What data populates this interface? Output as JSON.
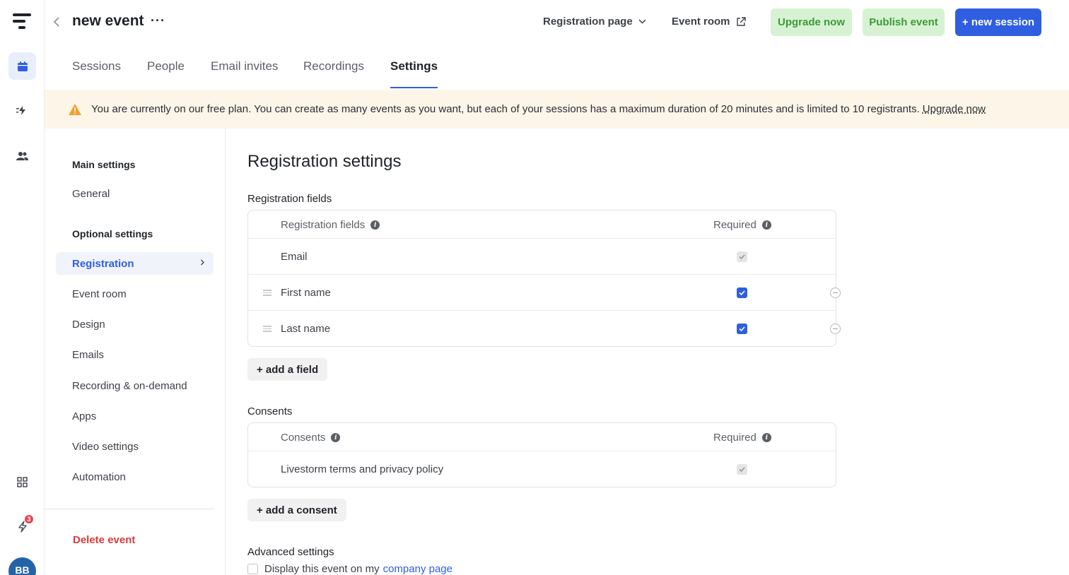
{
  "event": {
    "title": "new event",
    "more": "···"
  },
  "header": {
    "registration_page": "Registration page",
    "event_room": "Event room",
    "upgrade_now": "Upgrade now",
    "publish_event": "Publish event",
    "new_session": "+ new session"
  },
  "tabs": [
    {
      "label": "Sessions"
    },
    {
      "label": "People"
    },
    {
      "label": "Email invites"
    },
    {
      "label": "Recordings"
    },
    {
      "label": "Settings",
      "active": true
    }
  ],
  "banner": {
    "text": "You are currently on our free plan. You can create as many events as you want, but each of your sessions has a maximum duration of 20 minutes and is limited to 10 registrants.",
    "link": "Upgrade now"
  },
  "sidenav": {
    "main_heading": "Main settings",
    "main_items": [
      {
        "label": "General"
      }
    ],
    "optional_heading": "Optional settings",
    "optional_items": [
      {
        "label": "Registration",
        "active": true
      },
      {
        "label": "Event room"
      },
      {
        "label": "Design"
      },
      {
        "label": "Emails"
      },
      {
        "label": "Recording & on-demand"
      },
      {
        "label": "Apps"
      },
      {
        "label": "Video settings"
      },
      {
        "label": "Automation"
      }
    ],
    "delete": "Delete event"
  },
  "main": {
    "title": "Registration settings",
    "fields_heading": "Registration fields",
    "fields_table": {
      "col_name": "Registration fields",
      "col_required": "Required",
      "rows": [
        {
          "name": "Email",
          "required": "disabled-checked"
        },
        {
          "name": "First name",
          "required": "checked"
        },
        {
          "name": "Last name",
          "required": "checked"
        }
      ]
    },
    "add_field": "+ add a field",
    "consents_heading": "Consents",
    "consents_table": {
      "col_name": "Consents",
      "col_required": "Required",
      "rows": [
        {
          "name": "Livestorm terms and privacy policy",
          "required": "disabled-checked"
        }
      ]
    },
    "add_consent": "+ add a consent",
    "advanced_heading": "Advanced settings",
    "advanced_option": {
      "text": "Display this event on my",
      "link": "company page",
      "checked": false
    }
  },
  "rail": {
    "notification_count": "3",
    "avatar_initials": "BB"
  },
  "colors": {
    "accent": "#2f5fe0",
    "success_bg": "#d7f2d3",
    "success_text": "#3d9a3a",
    "danger": "#d93b3b",
    "banner_bg": "#fdf5e8"
  }
}
